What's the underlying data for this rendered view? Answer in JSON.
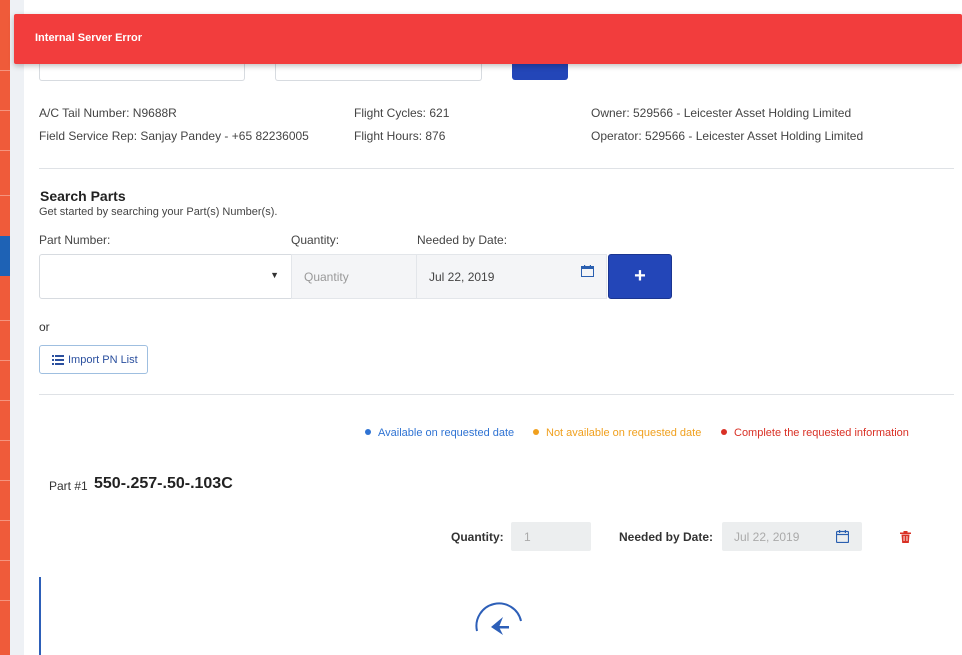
{
  "error": {
    "message": "Internal Server Error"
  },
  "aircraft": {
    "tail": "A/C Tail Number: N9688R",
    "field_rep": "Field Service Rep: Sanjay Pandey - +65 82236005",
    "cycles": "Flight Cycles: 621",
    "hours": "Flight Hours: 876",
    "owner": "Owner: 529566 - Leicester Asset Holding Limited",
    "operator": "Operator: 529566 - Leicester Asset Holding Limited"
  },
  "search": {
    "title": "Search Parts",
    "subtitle": "Get started by searching your Part(s) Number(s).",
    "part_number_label": "Part Number:",
    "quantity_label": "Quantity:",
    "needed_by_label": "Needed by Date:",
    "quantity_placeholder": "Quantity",
    "needed_by_value": "Jul 22, 2019",
    "add_label": "+",
    "or_text": "or",
    "import_label": "Import PN List"
  },
  "legend": [
    {
      "label": "Available on requested date",
      "color": "#2f73d3"
    },
    {
      "label": "Not available on requested date",
      "color": "#f0a01e"
    },
    {
      "label": "Complete the requested information",
      "color": "#d93025"
    }
  ],
  "part": {
    "prefix": "Part #1",
    "number": "550-.257-.50-.103C",
    "quantity_label": "Quantity:",
    "quantity_value": "1",
    "needed_by_label": "Needed by Date:",
    "needed_by_value": "Jul 22, 2019"
  },
  "colors": {
    "primary": "#2346b8",
    "error": "#f23d3d",
    "rail": "#ef5b3a",
    "nav": "#1f3f73"
  },
  "icons": [
    "calendar-icon",
    "plus-icon",
    "list-icon",
    "trash-icon",
    "chevron-down-icon",
    "loading-logo-icon"
  ]
}
